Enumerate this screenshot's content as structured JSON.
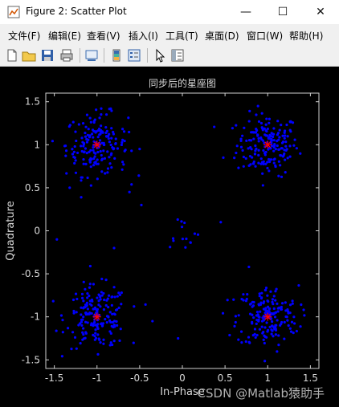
{
  "window": {
    "title": "Figure 2: Scatter Plot",
    "controls": [
      "—",
      "☐",
      "✕"
    ]
  },
  "menu": [
    {
      "label": "文件(F)"
    },
    {
      "label": "编辑(E)"
    },
    {
      "label": "查看(V)"
    },
    {
      "label": "插入(I)"
    },
    {
      "label": "工具(T)"
    },
    {
      "label": "桌面(D)"
    },
    {
      "label": "窗口(W)"
    },
    {
      "label": "帮助(H)"
    }
  ],
  "toolbar": {
    "icons": [
      "new-file-icon",
      "open-folder-icon",
      "save-icon",
      "print-icon",
      "link-icon",
      "colorbar-icon",
      "legend-icon",
      "select-arrow-icon",
      "property-editor-icon"
    ]
  },
  "watermark": "CSDN @Matlab猿助手",
  "chart_data": {
    "type": "scatter",
    "title": "同步后的星座图",
    "xlabel": "In-Phase",
    "ylabel": "Quadrature",
    "xlim": [
      -1.6,
      1.6
    ],
    "ylim": [
      -1.6,
      1.6
    ],
    "xticks": [
      "-1.5",
      "-1",
      "-0.5",
      "0",
      "0.5",
      "1",
      "1.5"
    ],
    "yticks": [
      "1.5",
      "1",
      "0.5",
      "0",
      "-0.5",
      "-1",
      "-1.5"
    ],
    "grid": false,
    "background": "#000000",
    "series": [
      {
        "color": "#0000ff",
        "marker": "dot",
        "clusters": [
          {
            "center": [
              1,
              1
            ],
            "points": 180,
            "spread": 0.18
          },
          {
            "center": [
              -1,
              1
            ],
            "points": 180,
            "spread": 0.18
          },
          {
            "center": [
              -1,
              -1
            ],
            "points": 180,
            "spread": 0.18
          },
          {
            "center": [
              1,
              -1
            ],
            "points": 180,
            "spread": 0.18
          },
          {
            "center": [
              0,
              0
            ],
            "points": 14,
            "spread": 0.1
          }
        ],
        "scattered_points": [
          [
            -1.47,
            -0.1
          ],
          [
            -1.32,
            0.5
          ],
          [
            -0.8,
            -0.2
          ],
          [
            -0.62,
            0.45
          ],
          [
            -0.7,
            0.8
          ],
          [
            0.48,
            0.85
          ],
          [
            0.45,
            0.1
          ],
          [
            -0.05,
            -1.25
          ],
          [
            0.6,
            -0.8
          ],
          [
            -0.48,
            0.3
          ],
          [
            0.78,
            -0.42
          ],
          [
            -0.35,
            -1.05
          ]
        ]
      },
      {
        "color": "#ff0000",
        "marker": "star",
        "points": [
          [
            1,
            1
          ],
          [
            -1,
            1
          ],
          [
            -1,
            -1
          ],
          [
            1,
            -1
          ]
        ]
      }
    ]
  }
}
